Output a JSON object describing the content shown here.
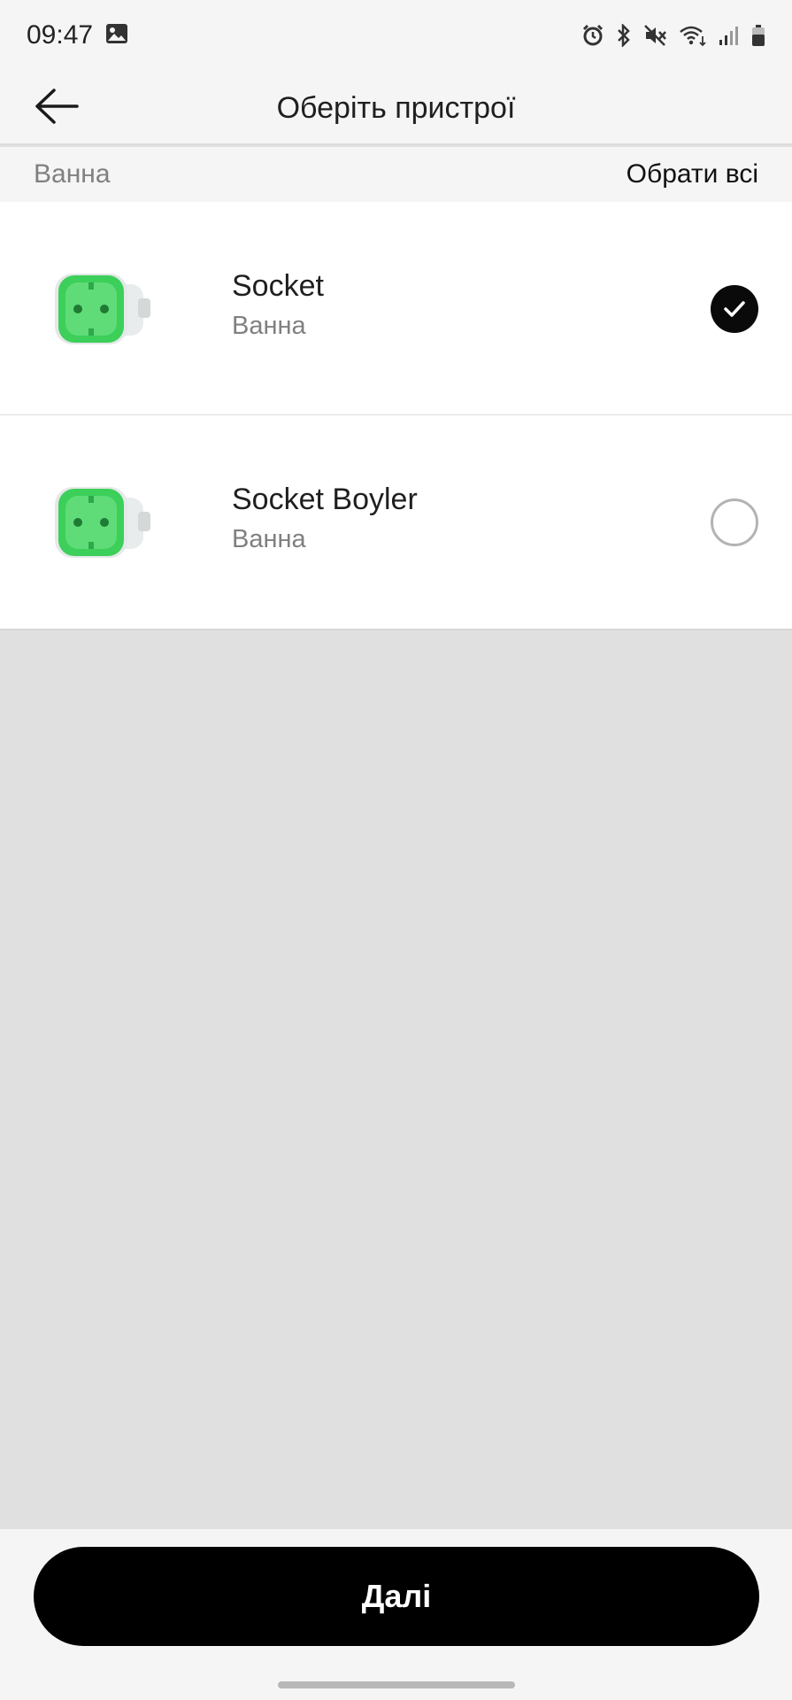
{
  "status_bar": {
    "time": "09:47",
    "left_icons": [
      "gallery-icon"
    ],
    "right_icons": [
      "alarm-icon",
      "bluetooth-icon",
      "mute-icon",
      "wifi-icon",
      "signal-icon",
      "battery-icon"
    ]
  },
  "app_bar": {
    "title": "Оберіть пристрої",
    "back_icon": "arrow-left-icon"
  },
  "group": {
    "name": "Ванна",
    "select_all_label": "Обрати всі"
  },
  "devices": [
    {
      "name": "Socket",
      "room": "Ванна",
      "selected": true,
      "icon": "socket-device-icon"
    },
    {
      "name": "Socket Boyler",
      "room": "Ванна",
      "selected": false,
      "icon": "socket-device-icon"
    }
  ],
  "footer": {
    "next_label": "Далі"
  },
  "colors": {
    "accent_green": "#3ccf5a",
    "button_black": "#000000",
    "background_gray": "#e0e0e0",
    "bar_gray": "#f5f5f5"
  }
}
